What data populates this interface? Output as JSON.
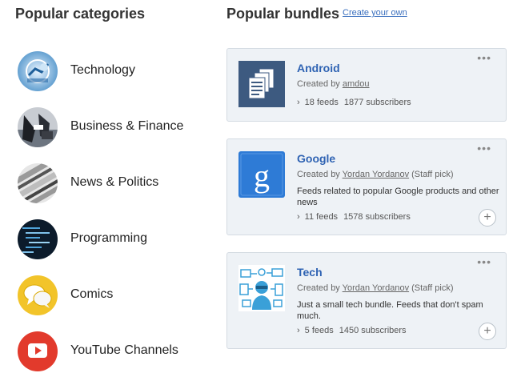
{
  "categories_heading": "Popular categories",
  "bundles_heading": "Popular bundles",
  "create_link": "Create your own",
  "categories": [
    {
      "label": "Technology",
      "icon": "technology-icon"
    },
    {
      "label": "Business & Finance",
      "icon": "business-icon"
    },
    {
      "label": "News & Politics",
      "icon": "news-icon"
    },
    {
      "label": "Programming",
      "icon": "programming-icon"
    },
    {
      "label": "Comics",
      "icon": "comics-icon"
    },
    {
      "label": "YouTube Channels",
      "icon": "youtube-icon"
    }
  ],
  "bundles": [
    {
      "title": "Android",
      "created_prefix": "Created by ",
      "author": "amdou",
      "staff_pick": "",
      "description": "",
      "feeds": "18 feeds",
      "subscribers": "1877 subscribers",
      "more": "•••",
      "add": "",
      "icon": "documents-icon",
      "color": "#3d5a80"
    },
    {
      "title": "Google",
      "created_prefix": "Created by ",
      "author": "Yordan Yordanov",
      "staff_pick": " (Staff pick)",
      "description": "Feeds related to popular Google products and other news",
      "feeds": "11 feeds",
      "subscribers": "1578 subscribers",
      "more": "•••",
      "add": "+",
      "icon": "google-icon",
      "color": "#2e7bd6"
    },
    {
      "title": "Tech",
      "created_prefix": "Created by ",
      "author": "Yordan Yordanov",
      "staff_pick": " (Staff pick)",
      "description": "Just a small tech bundle. Feeds that don't spam much.",
      "feeds": "5 feeds",
      "subscribers": "1450 subscribers",
      "more": "•••",
      "add": "+",
      "icon": "tech-icon",
      "color": "#3aa0d8"
    }
  ]
}
